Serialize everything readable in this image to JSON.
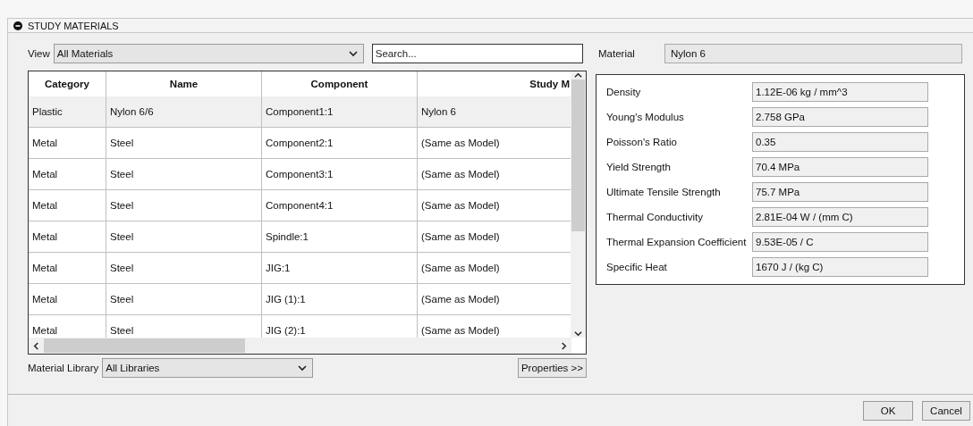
{
  "panel": {
    "title": "STUDY MATERIALS"
  },
  "view": {
    "label": "View",
    "value": "All Materials"
  },
  "search": {
    "placeholder": "Search..."
  },
  "table": {
    "columns": [
      "Category",
      "Name",
      "Component",
      "Study M"
    ],
    "rows": [
      {
        "cells": [
          "Plastic",
          "Nylon 6/6",
          "Component1:1",
          "Nylon 6"
        ],
        "selected": true
      },
      {
        "cells": [
          "Metal",
          "Steel",
          "Component2:1",
          "(Same as Model)"
        ],
        "selected": false
      },
      {
        "cells": [
          "Metal",
          "Steel",
          "Component3:1",
          "(Same as Model)"
        ],
        "selected": false
      },
      {
        "cells": [
          "Metal",
          "Steel",
          "Component4:1",
          "(Same as Model)"
        ],
        "selected": false
      },
      {
        "cells": [
          "Metal",
          "Steel",
          "Spindle:1",
          "(Same as Model)"
        ],
        "selected": false
      },
      {
        "cells": [
          "Metal",
          "Steel",
          "JIG:1",
          "(Same as Model)"
        ],
        "selected": false
      },
      {
        "cells": [
          "Metal",
          "Steel",
          "JIG (1):1",
          "(Same as Model)"
        ],
        "selected": false
      },
      {
        "cells": [
          "Metal",
          "Steel",
          "JIG (2):1",
          "(Same as Model)"
        ],
        "selected": false
      }
    ]
  },
  "material_library": {
    "label": "Material Library",
    "value": "All Libraries"
  },
  "properties_button": "Properties >>",
  "material": {
    "label": "Material",
    "value": "Nylon 6"
  },
  "properties": [
    {
      "label": "Density",
      "value": "1.12E-06 kg / mm^3"
    },
    {
      "label": "Young's Modulus",
      "value": "2.758 GPa"
    },
    {
      "label": "Poisson's Ratio",
      "value": "0.35"
    },
    {
      "label": "Yield Strength",
      "value": "70.4 MPa"
    },
    {
      "label": "Ultimate Tensile Strength",
      "value": "75.7 MPa"
    },
    {
      "label": "Thermal Conductivity",
      "value": "2.81E-04 W / (mm C)"
    },
    {
      "label": "Thermal Expansion Coefficient",
      "value": "9.53E-05 / C"
    },
    {
      "label": "Specific Heat",
      "value": "1670 J / (kg C)"
    }
  ],
  "buttons": [
    "OK",
    "Cancel"
  ]
}
